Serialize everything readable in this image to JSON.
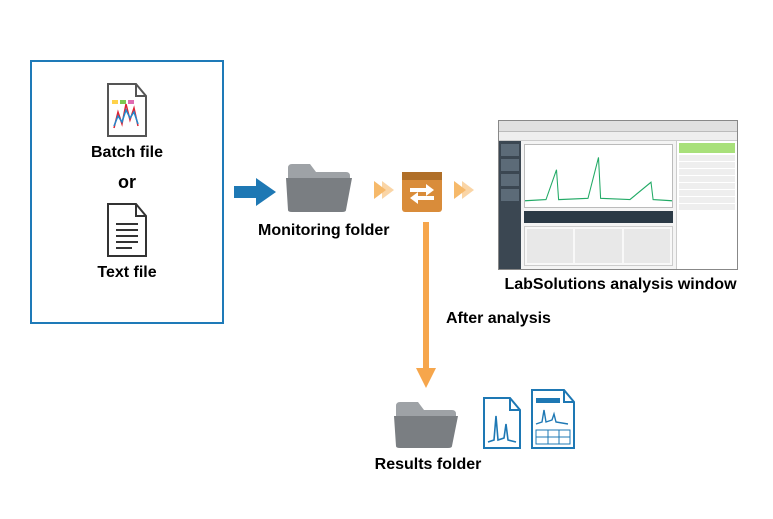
{
  "labels": {
    "batch_file": "Batch file",
    "or": "or",
    "text_file": "Text file",
    "monitoring_folder": "Monitoring folder",
    "analysis_window": "LabSolutions analysis window",
    "after_analysis": "After analysis",
    "results_folder": "Results folder"
  },
  "colors": {
    "box_border": "#1e7ab8",
    "arrow_blue": "#1e78b4",
    "arrow_orange": "#f6a64c",
    "folder_gray": "#7a7e82",
    "swap_box": "#d98c3a"
  }
}
